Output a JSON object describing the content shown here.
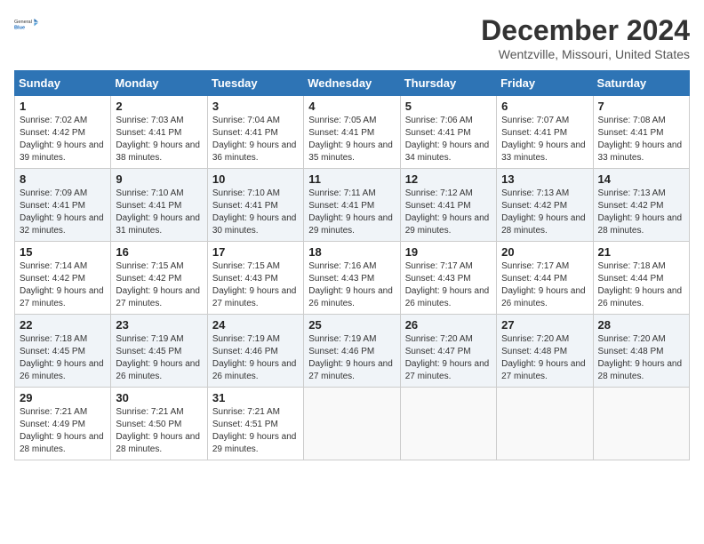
{
  "header": {
    "logo_general": "General",
    "logo_blue": "Blue",
    "month_title": "December 2024",
    "location": "Wentzville, Missouri, United States"
  },
  "days_of_week": [
    "Sunday",
    "Monday",
    "Tuesday",
    "Wednesday",
    "Thursday",
    "Friday",
    "Saturday"
  ],
  "weeks": [
    [
      {
        "day": "1",
        "sunrise": "7:02 AM",
        "sunset": "4:42 PM",
        "daylight": "9 hours and 39 minutes."
      },
      {
        "day": "2",
        "sunrise": "7:03 AM",
        "sunset": "4:41 PM",
        "daylight": "9 hours and 38 minutes."
      },
      {
        "day": "3",
        "sunrise": "7:04 AM",
        "sunset": "4:41 PM",
        "daylight": "9 hours and 36 minutes."
      },
      {
        "day": "4",
        "sunrise": "7:05 AM",
        "sunset": "4:41 PM",
        "daylight": "9 hours and 35 minutes."
      },
      {
        "day": "5",
        "sunrise": "7:06 AM",
        "sunset": "4:41 PM",
        "daylight": "9 hours and 34 minutes."
      },
      {
        "day": "6",
        "sunrise": "7:07 AM",
        "sunset": "4:41 PM",
        "daylight": "9 hours and 33 minutes."
      },
      {
        "day": "7",
        "sunrise": "7:08 AM",
        "sunset": "4:41 PM",
        "daylight": "9 hours and 33 minutes."
      }
    ],
    [
      {
        "day": "8",
        "sunrise": "7:09 AM",
        "sunset": "4:41 PM",
        "daylight": "9 hours and 32 minutes."
      },
      {
        "day": "9",
        "sunrise": "7:10 AM",
        "sunset": "4:41 PM",
        "daylight": "9 hours and 31 minutes."
      },
      {
        "day": "10",
        "sunrise": "7:10 AM",
        "sunset": "4:41 PM",
        "daylight": "9 hours and 30 minutes."
      },
      {
        "day": "11",
        "sunrise": "7:11 AM",
        "sunset": "4:41 PM",
        "daylight": "9 hours and 29 minutes."
      },
      {
        "day": "12",
        "sunrise": "7:12 AM",
        "sunset": "4:41 PM",
        "daylight": "9 hours and 29 minutes."
      },
      {
        "day": "13",
        "sunrise": "7:13 AM",
        "sunset": "4:42 PM",
        "daylight": "9 hours and 28 minutes."
      },
      {
        "day": "14",
        "sunrise": "7:13 AM",
        "sunset": "4:42 PM",
        "daylight": "9 hours and 28 minutes."
      }
    ],
    [
      {
        "day": "15",
        "sunrise": "7:14 AM",
        "sunset": "4:42 PM",
        "daylight": "9 hours and 27 minutes."
      },
      {
        "day": "16",
        "sunrise": "7:15 AM",
        "sunset": "4:42 PM",
        "daylight": "9 hours and 27 minutes."
      },
      {
        "day": "17",
        "sunrise": "7:15 AM",
        "sunset": "4:43 PM",
        "daylight": "9 hours and 27 minutes."
      },
      {
        "day": "18",
        "sunrise": "7:16 AM",
        "sunset": "4:43 PM",
        "daylight": "9 hours and 26 minutes."
      },
      {
        "day": "19",
        "sunrise": "7:17 AM",
        "sunset": "4:43 PM",
        "daylight": "9 hours and 26 minutes."
      },
      {
        "day": "20",
        "sunrise": "7:17 AM",
        "sunset": "4:44 PM",
        "daylight": "9 hours and 26 minutes."
      },
      {
        "day": "21",
        "sunrise": "7:18 AM",
        "sunset": "4:44 PM",
        "daylight": "9 hours and 26 minutes."
      }
    ],
    [
      {
        "day": "22",
        "sunrise": "7:18 AM",
        "sunset": "4:45 PM",
        "daylight": "9 hours and 26 minutes."
      },
      {
        "day": "23",
        "sunrise": "7:19 AM",
        "sunset": "4:45 PM",
        "daylight": "9 hours and 26 minutes."
      },
      {
        "day": "24",
        "sunrise": "7:19 AM",
        "sunset": "4:46 PM",
        "daylight": "9 hours and 26 minutes."
      },
      {
        "day": "25",
        "sunrise": "7:19 AM",
        "sunset": "4:46 PM",
        "daylight": "9 hours and 27 minutes."
      },
      {
        "day": "26",
        "sunrise": "7:20 AM",
        "sunset": "4:47 PM",
        "daylight": "9 hours and 27 minutes."
      },
      {
        "day": "27",
        "sunrise": "7:20 AM",
        "sunset": "4:48 PM",
        "daylight": "9 hours and 27 minutes."
      },
      {
        "day": "28",
        "sunrise": "7:20 AM",
        "sunset": "4:48 PM",
        "daylight": "9 hours and 28 minutes."
      }
    ],
    [
      {
        "day": "29",
        "sunrise": "7:21 AM",
        "sunset": "4:49 PM",
        "daylight": "9 hours and 28 minutes."
      },
      {
        "day": "30",
        "sunrise": "7:21 AM",
        "sunset": "4:50 PM",
        "daylight": "9 hours and 28 minutes."
      },
      {
        "day": "31",
        "sunrise": "7:21 AM",
        "sunset": "4:51 PM",
        "daylight": "9 hours and 29 minutes."
      },
      null,
      null,
      null,
      null
    ]
  ],
  "labels": {
    "sunrise": "Sunrise:",
    "sunset": "Sunset:",
    "daylight": "Daylight:"
  }
}
